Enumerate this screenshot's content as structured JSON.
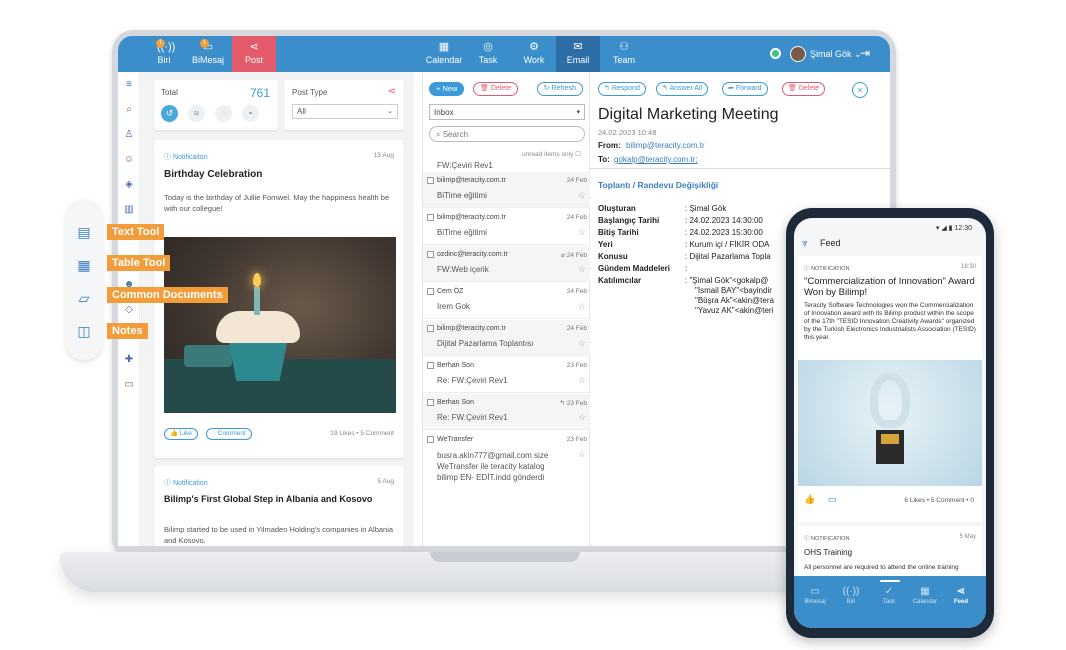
{
  "topbar": {
    "left_items": [
      {
        "label": "Biri",
        "badge": "1"
      },
      {
        "label": "BiMesaj",
        "badge": "1"
      },
      {
        "label": "Post"
      }
    ],
    "center_items": [
      {
        "label": "Calendar"
      },
      {
        "label": "Task"
      },
      {
        "label": "Work"
      },
      {
        "label": "Email"
      },
      {
        "label": "Team"
      }
    ],
    "user_name": "Şimal Gök"
  },
  "feed": {
    "total_label": "Total",
    "total_count": "761",
    "post_type_label": "Post Type",
    "post_type_value": "All",
    "posts": [
      {
        "tag": "Notificaiton",
        "date": "15 Aug",
        "title": "Birthday Celebration",
        "text": "Today is the birthday of Jullie Fornwel. May the happiness health be with our collegue!",
        "like": "Like",
        "comment": "Comment",
        "stats": "19 Likes • 5 Comment"
      },
      {
        "tag": "Notification",
        "date": "5 Aug",
        "title": "Bilimp's First Global Step in Albania and Kosovo",
        "text": "Bilimp started to be used in Yilmaden Holding's companies in Albania and Kosovo."
      }
    ]
  },
  "email_list": {
    "new_label": "+ New",
    "delete_label": "Delete",
    "refresh_label": "Refresh",
    "folder": "Inbox",
    "search_placeholder": "Search",
    "unread_label": "unread items only",
    "first_subject": "FW:Çeviri Rev1",
    "rows": [
      {
        "from": "bilimp@teracity.com.tr",
        "date": "24 Feb",
        "subject": "BiTime eğitimi"
      },
      {
        "from": "bilimp@teracity.com.tr",
        "date": "24 Feb",
        "subject": "BiTime eğitimi"
      },
      {
        "from": "ozdinc@teracity.com.tr",
        "date": "24 Feb",
        "subject": "FW:Web içerik"
      },
      {
        "from": "Cem ÖZ",
        "date": "24 Feb",
        "subject": "Irem Gok"
      },
      {
        "from": "bilimp@teracity.com.tr",
        "date": "24 Feb",
        "subject": "Dijital Pazarlama Toplantısı"
      },
      {
        "from": "Berhan Son",
        "date": "23 Feb",
        "subject": "Re: FW:Çeviri Rev1"
      },
      {
        "from": "Berhan Son",
        "date": "23 Feb",
        "subject": "Re: FW:Çeviri Rev1"
      },
      {
        "from": "WeTransfer",
        "date": "23 Feb",
        "subject": "busra.akin777@gmail.com size WeTransfer ile teracity katalog bilimp EN- EDİT.indd gönderdi"
      }
    ]
  },
  "reader": {
    "respond": "Respond",
    "answer_all": "Answer All",
    "forward": "Forward",
    "delete": "Delete",
    "title": "Digital Marketing Meeting",
    "datetime": "24.02.2023 10:48",
    "from_label": "From:",
    "from_value": "bilimp@teracity.com.tr",
    "to_label": "To:",
    "to_value": "gokalp@teracity.com.tr;",
    "section_title": "Toplantı / Randevu Değişikliği",
    "fields": [
      {
        "key": "Oluşturan",
        "value": "Şimal Gök"
      },
      {
        "key": "Başlangıç Tarihi",
        "value": "24.02.2023 14:30:00"
      },
      {
        "key": "Bitiş Tarihi",
        "value": "24.02.2023 15:30:00"
      },
      {
        "key": "Yeri",
        "value": "Kurum içi / FİKİR ODA"
      },
      {
        "key": "Konusu",
        "value": "Dijital Pazarlama Topla"
      },
      {
        "key": "Gündem Maddeleri",
        "value": ""
      },
      {
        "key": "Katılımcılar",
        "value": "\"Şimal Gök\"<gokalp@"
      }
    ],
    "participants": [
      "\"İsmail BAY\"<bayindir",
      "\"Büşra Ak\"<akin@tera",
      "\"Yavuz AK\"<akin@teri"
    ]
  },
  "toolbox": {
    "items": [
      {
        "label": "Text Tool",
        "icon": "document-icon"
      },
      {
        "label": "Table Tool",
        "icon": "table-icon"
      },
      {
        "label": "Common Documents",
        "icon": "folder-icon"
      },
      {
        "label": "Notes",
        "icon": "note-icon"
      }
    ]
  },
  "phone": {
    "time": "12:30",
    "header": "Feed",
    "posts": [
      {
        "tag": "NOTIFICATION",
        "time": "18:30",
        "title": "\"Commercialization of Innovation\" Award Won by Bilimp!",
        "text": "Teracity Software Technologies won the Commercialization of Innovation award with its Bilimp product within the scope of the 17th \"TESID Innovation Creativity Awards\" organized by the Turkish Electronics Industrialists Association (TESID) this year.",
        "stats": "6 Likes • 5 Comment • 0"
      },
      {
        "tag": "NOTIFICATION",
        "time": "5 May",
        "title": "OHS Training",
        "text": "All personnel are required to attend the online training"
      }
    ],
    "tabs": [
      "Bimesaj",
      "Biri",
      "Task",
      "Calendar",
      "Feed"
    ]
  }
}
